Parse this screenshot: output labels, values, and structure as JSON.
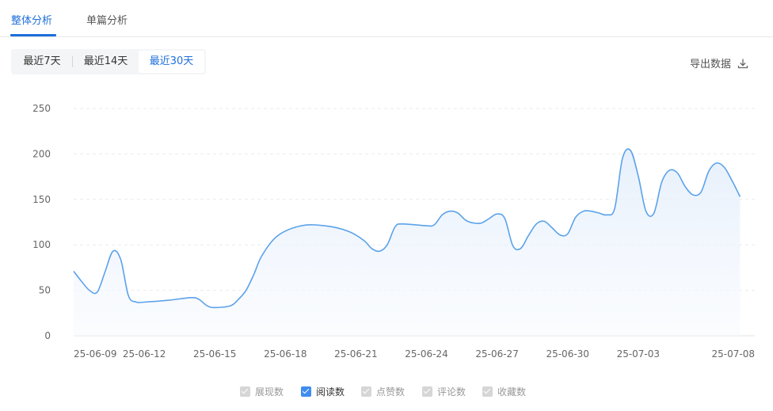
{
  "tabs": [
    {
      "label": "整体分析",
      "active": true
    },
    {
      "label": "单篇分析",
      "active": false
    }
  ],
  "ranges": [
    {
      "label": "最近7天",
      "active": false
    },
    {
      "label": "最近14天",
      "active": false
    },
    {
      "label": "最近30天",
      "active": true
    }
  ],
  "export": {
    "label": "导出数据",
    "icon": "download-icon"
  },
  "colors": {
    "accent": "#1e6fdb",
    "line": "#5ba2ea",
    "area": "#e8f1fc"
  },
  "chart_data": {
    "type": "area",
    "ylim": [
      0,
      250
    ],
    "yticks": [
      0,
      50,
      100,
      150,
      200,
      250
    ],
    "xtick_labels": [
      "25-06-09",
      "25-06-12",
      "25-06-15",
      "25-06-18",
      "25-06-21",
      "25-06-24",
      "25-06-27",
      "25-06-30",
      "25-07-03",
      "25-07-08"
    ],
    "grid": true,
    "legend_position": "bottom",
    "series": [
      {
        "name": "阅读数",
        "values": [
          [
            0.0,
            71
          ],
          [
            0.33,
            60
          ],
          [
            0.67,
            50
          ],
          [
            1.0,
            48
          ],
          [
            1.33,
            70
          ],
          [
            1.67,
            93
          ],
          [
            2.0,
            84
          ],
          [
            2.33,
            44
          ],
          [
            2.67,
            37
          ],
          [
            3.0,
            37
          ],
          [
            4.0,
            39
          ],
          [
            5.0,
            42
          ],
          [
            5.33,
            40
          ],
          [
            5.67,
            33
          ],
          [
            6.0,
            31
          ],
          [
            6.67,
            33
          ],
          [
            7.0,
            40
          ],
          [
            7.33,
            50
          ],
          [
            7.67,
            68
          ],
          [
            8.0,
            88
          ],
          [
            8.67,
            110
          ],
          [
            9.67,
            121
          ],
          [
            10.67,
            121
          ],
          [
            11.67,
            115
          ],
          [
            12.33,
            105
          ],
          [
            12.67,
            96
          ],
          [
            13.0,
            93
          ],
          [
            13.33,
            100
          ],
          [
            13.67,
            120
          ],
          [
            14.0,
            123
          ],
          [
            15.0,
            121
          ],
          [
            15.33,
            122
          ],
          [
            15.67,
            133
          ],
          [
            16.0,
            137
          ],
          [
            16.33,
            135
          ],
          [
            16.67,
            127
          ],
          [
            17.0,
            124
          ],
          [
            17.33,
            124
          ],
          [
            17.67,
            129
          ],
          [
            18.0,
            134
          ],
          [
            18.33,
            129
          ],
          [
            18.67,
            99
          ],
          [
            19.0,
            96
          ],
          [
            19.33,
            110
          ],
          [
            19.67,
            123
          ],
          [
            20.0,
            126
          ],
          [
            20.33,
            119
          ],
          [
            20.67,
            111
          ],
          [
            21.0,
            112
          ],
          [
            21.33,
            130
          ],
          [
            21.67,
            137
          ],
          [
            22.0,
            137
          ],
          [
            22.33,
            135
          ],
          [
            22.67,
            133
          ],
          [
            23.0,
            140
          ],
          [
            23.33,
            195
          ],
          [
            23.67,
            204
          ],
          [
            24.0,
            176
          ],
          [
            24.33,
            137
          ],
          [
            24.67,
            135
          ],
          [
            25.0,
            169
          ],
          [
            25.33,
            182
          ],
          [
            25.67,
            179
          ],
          [
            26.0,
            164
          ],
          [
            26.33,
            155
          ],
          [
            26.67,
            158
          ],
          [
            27.0,
            181
          ],
          [
            27.33,
            190
          ],
          [
            27.67,
            185
          ],
          [
            28.0,
            170
          ],
          [
            28.33,
            153
          ]
        ]
      }
    ]
  },
  "legend": [
    {
      "label": "展现数",
      "checked": false
    },
    {
      "label": "阅读数",
      "checked": true
    },
    {
      "label": "点赞数",
      "checked": false
    },
    {
      "label": "评论数",
      "checked": false
    },
    {
      "label": "收藏数",
      "checked": false
    }
  ]
}
